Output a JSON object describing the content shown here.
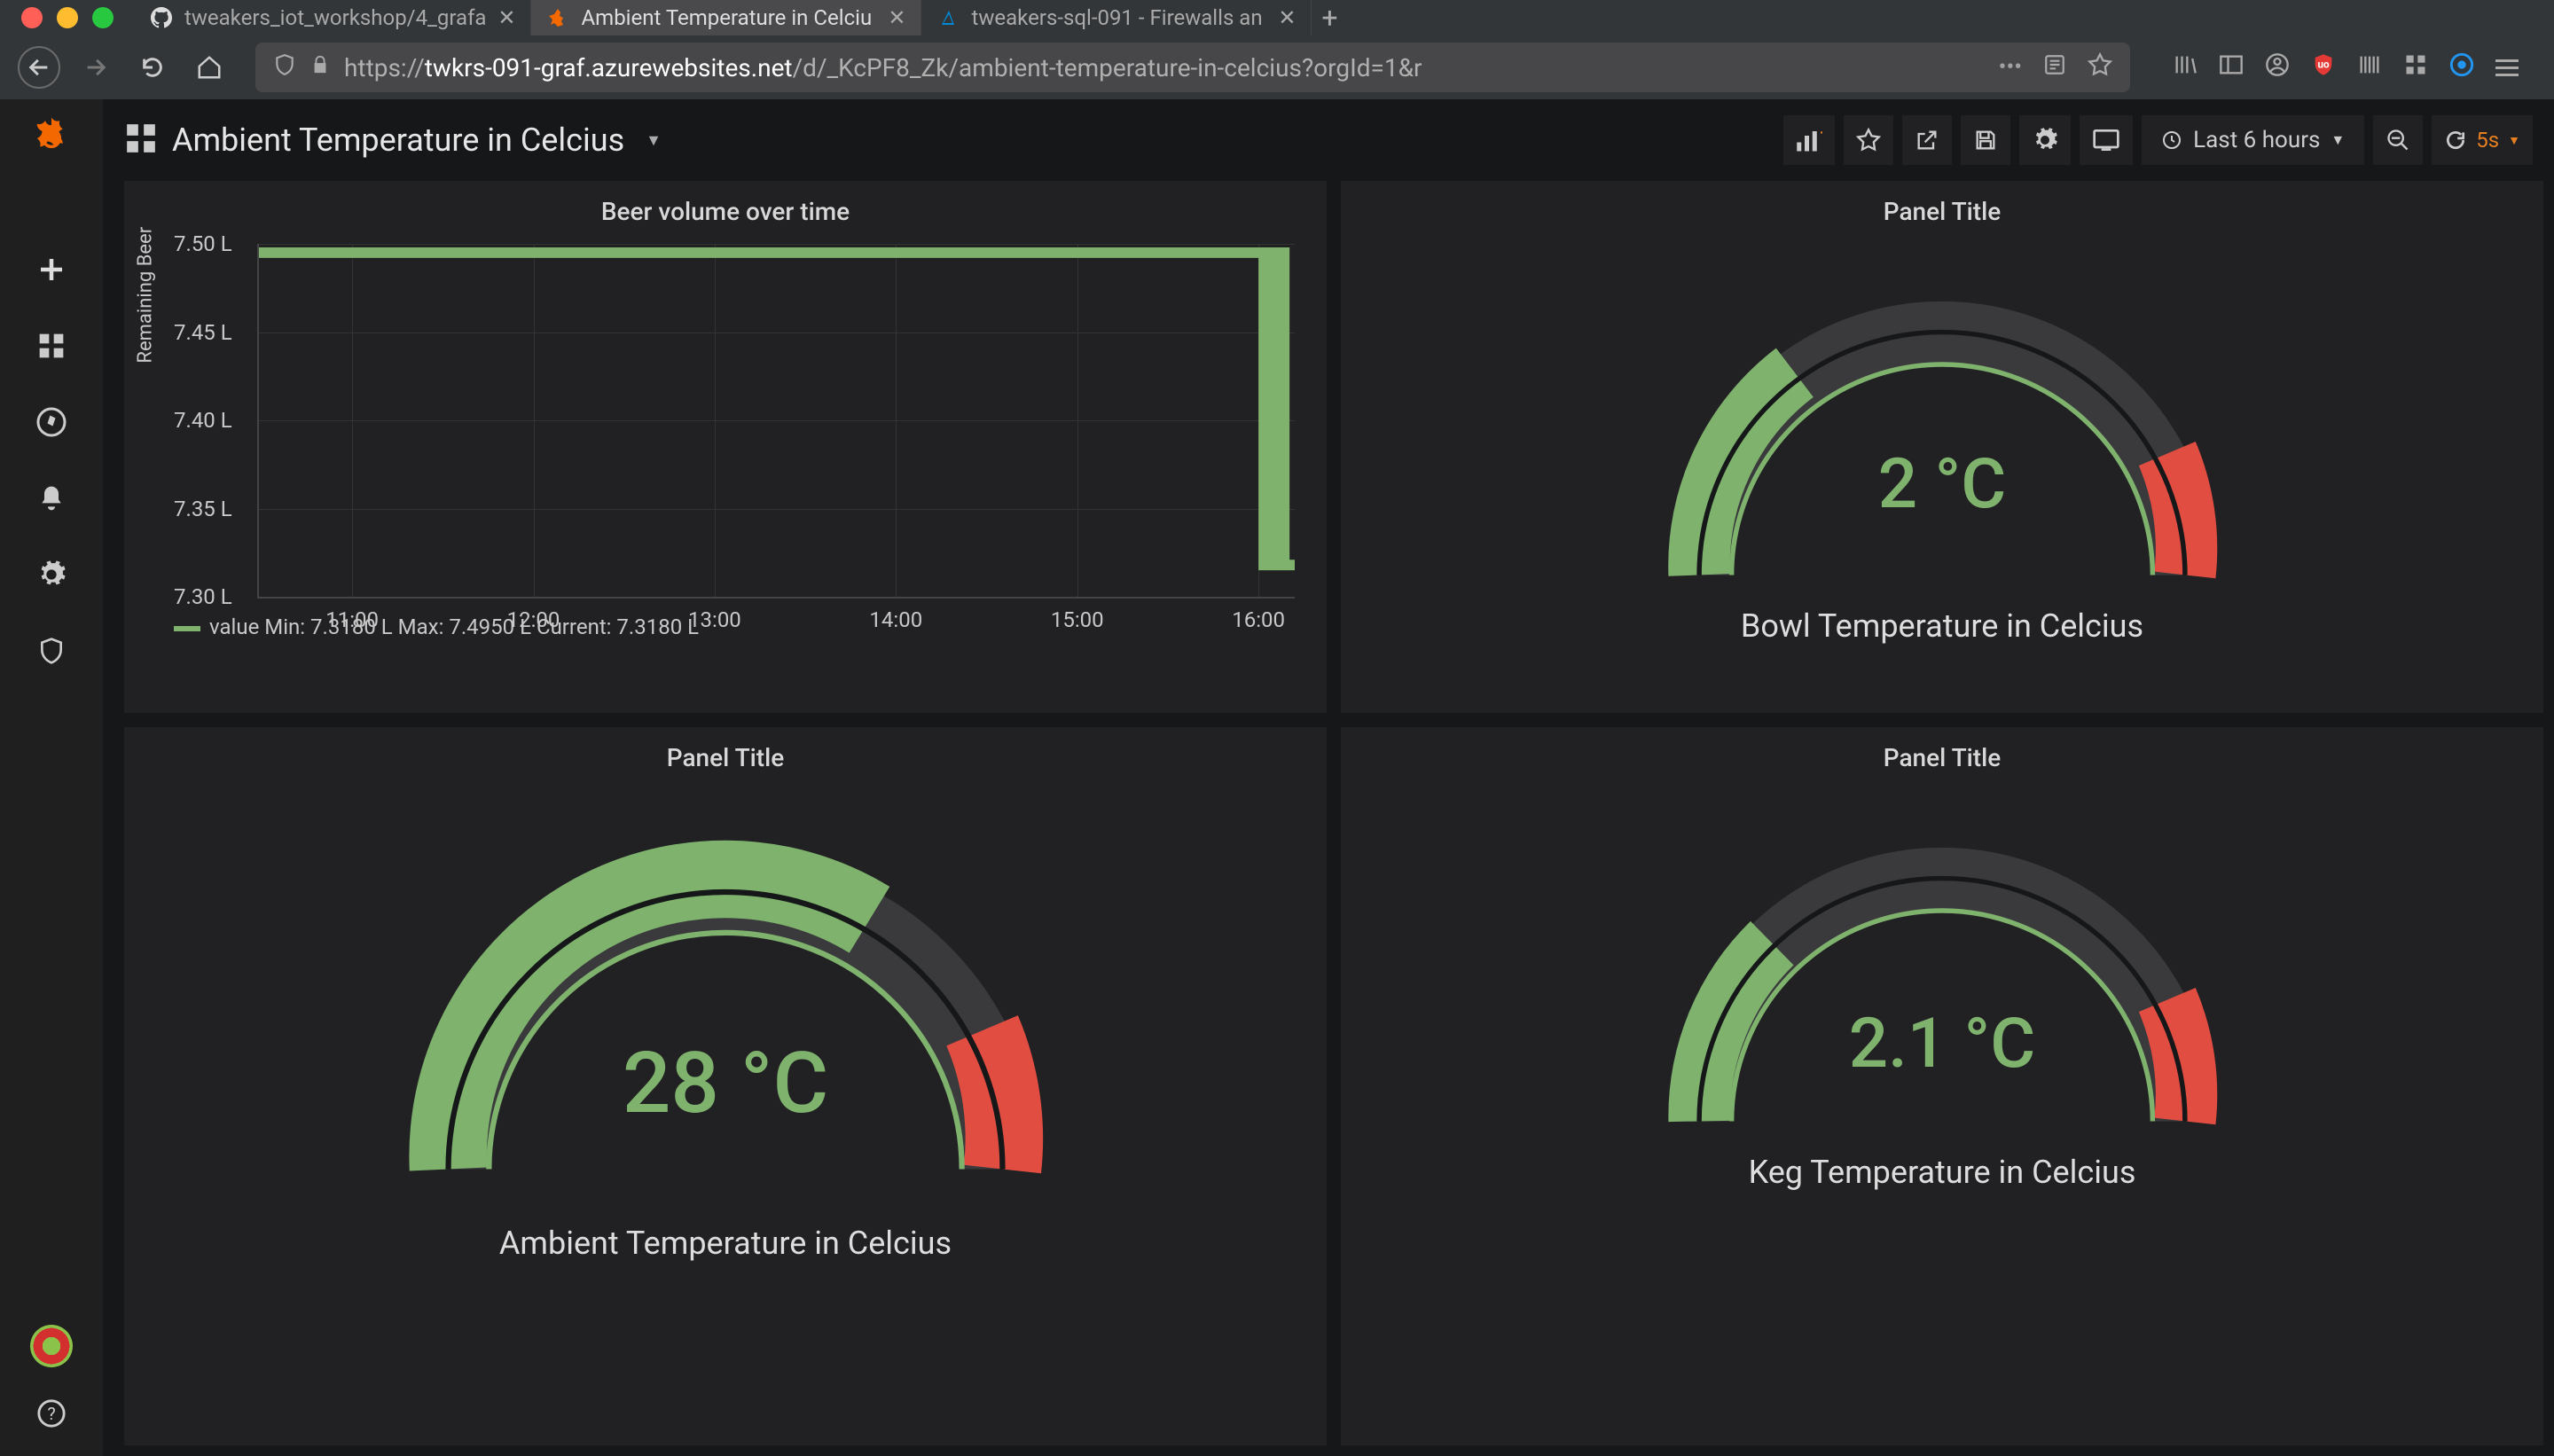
{
  "browser": {
    "tabs": [
      {
        "title": "tweakers_iot_workshop/4_grafa",
        "favicon": "github"
      },
      {
        "title": "Ambient Temperature in Celciu",
        "favicon": "grafana",
        "active": true
      },
      {
        "title": "tweakers-sql-091 - Firewalls an",
        "favicon": "azure"
      }
    ],
    "url_prefix": "https://",
    "url_host": "twkrs-091-graf.azurewebsites.net",
    "url_path": "/d/_KcPF8_Zk/ambient-temperature-in-celcius?orgId=1&r"
  },
  "grafana": {
    "dashboard_title": "Ambient Temperature in Celcius",
    "time_range_label": "Last 6 hours",
    "refresh_label": "5s",
    "sidebar_items": [
      "plus",
      "dashboards",
      "explore",
      "alerting",
      "configuration",
      "server-admin"
    ]
  },
  "panels": {
    "beer": {
      "title": "Beer volume over time",
      "ylabel": "Remaining Beer",
      "legend": "value  Min: 7.3180 L  Max: 7.4950 L  Current: 7.3180 L"
    },
    "gauge_bowl": {
      "title": "Panel Title",
      "value": "2 °C",
      "label": "Bowl Temperature in Celcius"
    },
    "gauge_ambient": {
      "title": "Panel Title",
      "value": "28 °C",
      "label": "Ambient Temperature in Celcius"
    },
    "gauge_keg": {
      "title": "Panel Title",
      "value": "2.1 °C",
      "label": "Keg Temperature in Celcius"
    }
  },
  "chart_data": [
    {
      "type": "line",
      "panel": "Beer volume over time",
      "ylabel": "Remaining Beer",
      "ylim": [
        7.3,
        7.5
      ],
      "yticks": [
        "7.30 L",
        "7.35 L",
        "7.40 L",
        "7.45 L",
        "7.50 L"
      ],
      "xticks": [
        "11:00",
        "12:00",
        "13:00",
        "14:00",
        "15:00",
        "16:00"
      ],
      "x": [
        "10:30",
        "11:00",
        "12:00",
        "13:00",
        "14:00",
        "15:00",
        "16:00",
        "16:10",
        "16:15",
        "16:20"
      ],
      "series": [
        {
          "name": "value",
          "values": [
            7.495,
            7.495,
            7.495,
            7.495,
            7.495,
            7.495,
            7.495,
            7.495,
            7.318,
            7.318
          ]
        }
      ],
      "stats": {
        "min": 7.318,
        "max": 7.495,
        "current": 7.318
      }
    },
    {
      "type": "gauge",
      "panel": "Bowl Temperature in Celcius",
      "value": 2,
      "unit": "°C",
      "range": [
        0,
        100
      ],
      "fill_pct": 28,
      "thresholds": {
        "green": 80,
        "red": 100
      }
    },
    {
      "type": "gauge",
      "panel": "Ambient Temperature in Celcius",
      "value": 28,
      "unit": "°C",
      "range": [
        0,
        100
      ],
      "fill_pct": 65,
      "thresholds": {
        "green": 80,
        "red": 100
      }
    },
    {
      "type": "gauge",
      "panel": "Keg Temperature in Celcius",
      "value": 2.1,
      "unit": "°C",
      "range": [
        0,
        100
      ],
      "fill_pct": 22,
      "thresholds": {
        "green": 80,
        "red": 100
      }
    }
  ]
}
